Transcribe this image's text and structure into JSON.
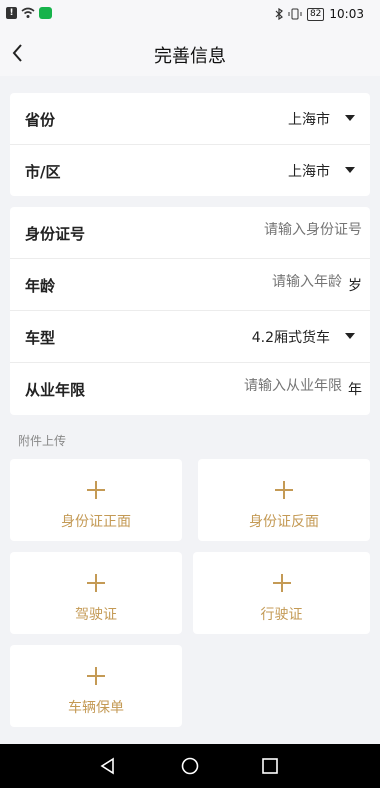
{
  "status_bar": {
    "time": "10:03",
    "battery": "82",
    "notice": "!"
  },
  "header": {
    "title": "完善信息"
  },
  "location_card": {
    "province": {
      "label": "省份",
      "value": "上海市"
    },
    "city": {
      "label": "市/区",
      "value": "上海市"
    }
  },
  "info_card": {
    "id_number": {
      "label": "身份证号",
      "placeholder": "请输入身份证号"
    },
    "age": {
      "label": "年龄",
      "placeholder": "请输入年龄",
      "unit": "岁"
    },
    "vehicle": {
      "label": "车型",
      "value": "4.2厢式货车"
    },
    "experience": {
      "label": "从业年限",
      "placeholder": "请输入从业年限",
      "unit": "年"
    }
  },
  "attachments": {
    "title": "附件上传",
    "items": [
      {
        "label": "身份证正面"
      },
      {
        "label": "身份证反面"
      },
      {
        "label": "驾驶证"
      },
      {
        "label": "行驶证"
      },
      {
        "label": "车辆保单"
      }
    ]
  },
  "colors": {
    "accent": "#c49a55",
    "background": "#f2f3f6"
  }
}
